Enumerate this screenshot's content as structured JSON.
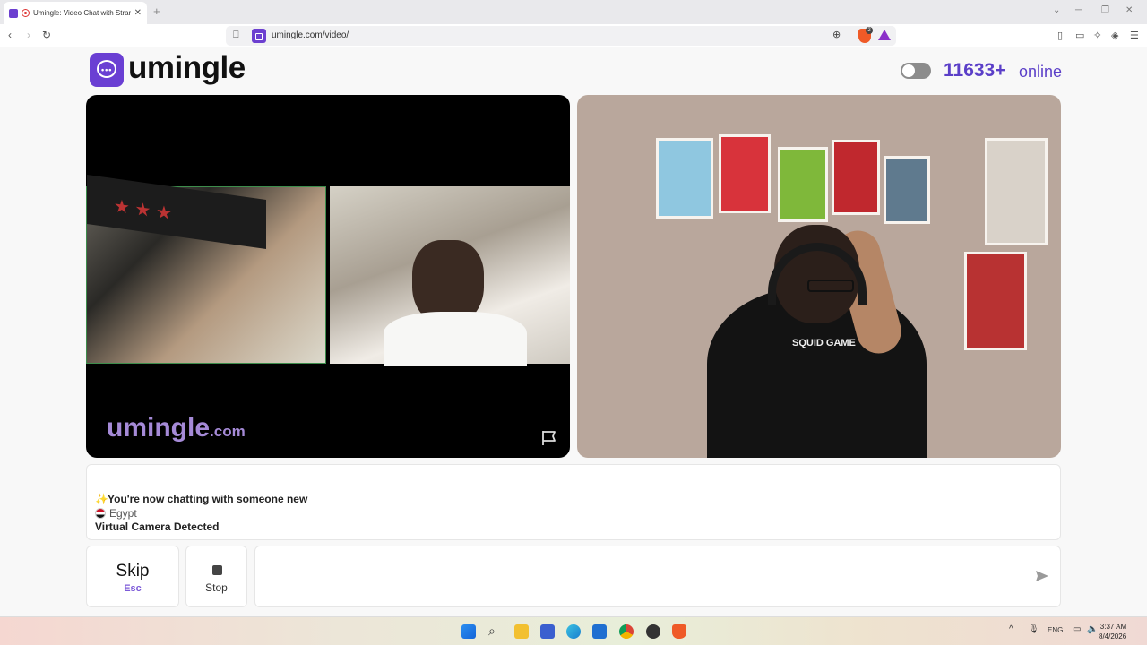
{
  "browser": {
    "tab_title": "Umingle: Video Chat with Strangers",
    "new_tab": "+",
    "url": "umingle.com/video/",
    "shield_count": "2"
  },
  "header": {
    "logo_text": "umingle",
    "online_count": "11633+",
    "online_label": "online",
    "toggle_on": false
  },
  "video": {
    "watermark_main": "umingle",
    "watermark_suffix": ".com",
    "stranger_shirt_text": "SQUID GAME"
  },
  "chat": {
    "system_message": "You're now chatting with someone new",
    "country": "Egypt",
    "notice": "Virtual Camera Detected"
  },
  "controls": {
    "skip_label": "Skip",
    "skip_key": "Esc",
    "stop_label": "Stop",
    "message_placeholder": ""
  },
  "taskbar": {
    "lang": "ENG",
    "time": "3:37 AM",
    "date": "8/4/2026"
  },
  "colors": {
    "brand": "#6a3fd3",
    "online": "#5b3fc8",
    "watermark": "#a58ad7"
  }
}
